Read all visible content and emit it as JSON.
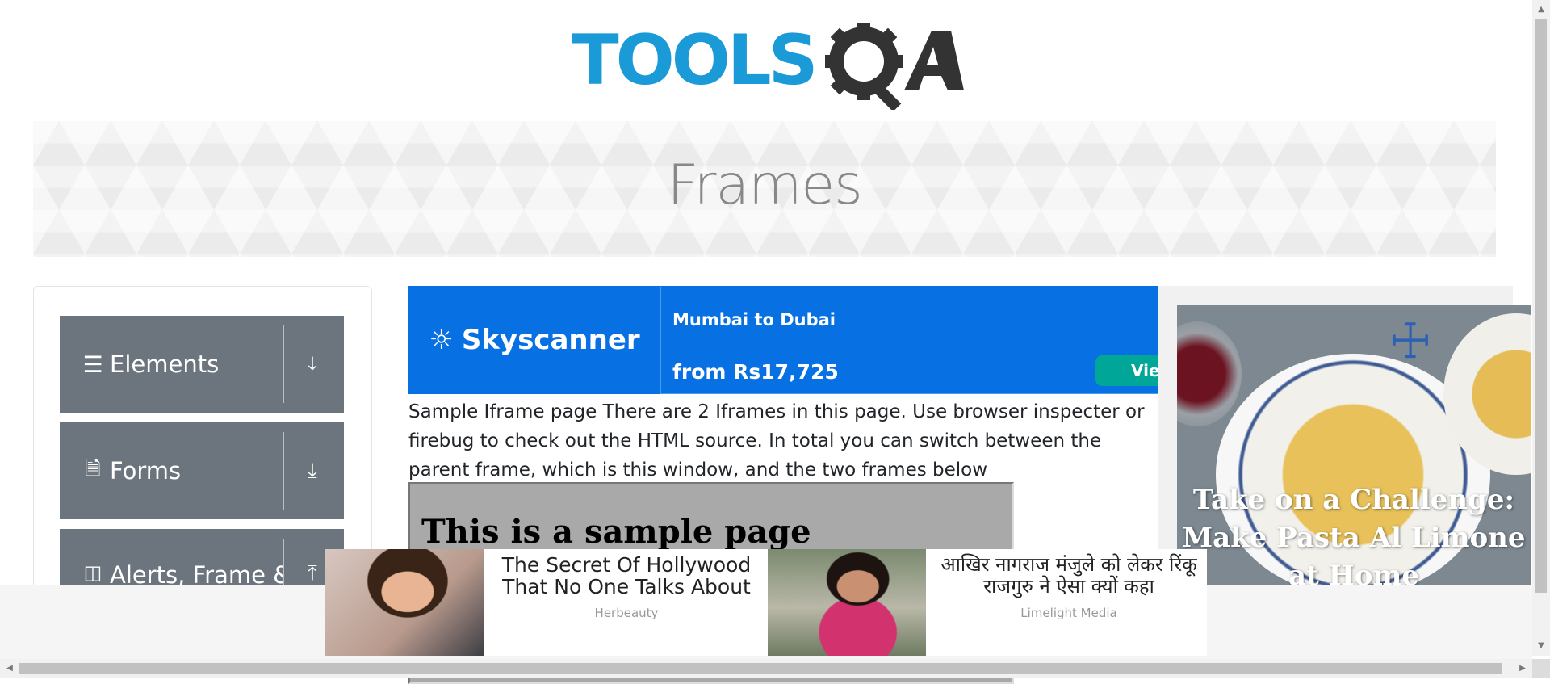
{
  "header": {
    "logo_text_1": "TOOLS",
    "logo_text_2": "QA",
    "page_title": "Frames"
  },
  "sidebar": {
    "groups": [
      {
        "label": "Elements",
        "icon": "menu-icon",
        "arrow": "download-icon"
      },
      {
        "label": "Forms",
        "icon": "document-icon",
        "arrow": "download-icon"
      },
      {
        "label": "Alerts, Frame & Windows",
        "icon": "window-icon",
        "arrow": "upload-icon"
      }
    ]
  },
  "ad_skyscanner": {
    "brand": "Skyscanner",
    "route": "Mumbai to Dubai",
    "price": "from Rs17,725",
    "cta": "View"
  },
  "main": {
    "description": "Sample Iframe page There are 2 Iframes in this page. Use browser inspecter or firebug to check out the HTML source. In total you can switch between the parent frame, which is this window, and the two frames below",
    "frame1_heading": "This is a sample page"
  },
  "ad_side": {
    "caption": "Take on a Challenge: Make Pasta Al Limone at Home"
  },
  "ad_bottom": {
    "items": [
      {
        "title": "The Secret Of Hollywood That No One Talks About",
        "source": "Herbeauty"
      },
      {
        "title": "आखिर नागराज मंजुले को लेकर रिंकू राजगुरु ने ऐसा क्यों कहा",
        "source": "Limelight Media"
      }
    ]
  },
  "colors": {
    "logo_blue": "#1a9ad6",
    "logo_dark": "#333333",
    "sidebar_group_bg": "#6c757d",
    "skyscanner_blue": "#0770e3",
    "skyscanner_cta": "#00a698",
    "frame_bg": "#a9a9a9"
  }
}
